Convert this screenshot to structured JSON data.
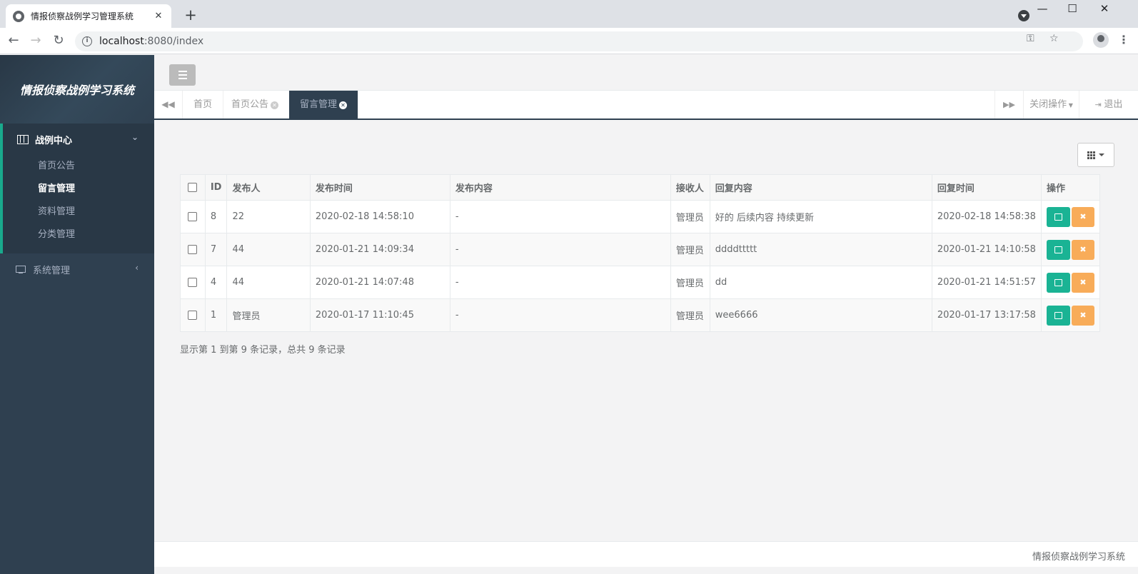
{
  "browser": {
    "tab_title": "情报侦察战例学习管理系统",
    "tab_close": "✕",
    "new_tab": "+",
    "url_host": "localhost",
    "url_rest": ":8080/index",
    "icons": [
      "globe-icon",
      "back-icon",
      "forward-icon",
      "reload-icon",
      "info-icon",
      "key-icon",
      "star-icon",
      "profile-icon",
      "menu-icon"
    ]
  },
  "sidebar": {
    "brand": "情报侦察战例学习系统",
    "group1": {
      "label": "战例中心",
      "items": [
        {
          "label": "首页公告",
          "active": false
        },
        {
          "label": "留言管理",
          "active": true
        },
        {
          "label": "资料管理",
          "active": false
        },
        {
          "label": "分类管理",
          "active": false
        }
      ]
    },
    "group2": {
      "label": "系统管理"
    }
  },
  "tabs": {
    "items": [
      {
        "label": "首页",
        "closable": false,
        "active": false
      },
      {
        "label": "首页公告",
        "closable": true,
        "active": false
      },
      {
        "label": "留言管理",
        "closable": true,
        "active": true
      }
    ],
    "close_ops": "关闭操作",
    "logout": "退出"
  },
  "table": {
    "headers": [
      "ID",
      "发布人",
      "发布时间",
      "发布内容",
      "接收人",
      "回复内容",
      "回复时间",
      "操作"
    ],
    "rows": [
      {
        "id": "8",
        "publisher": "22",
        "pub_time": "2020-02-18 14:58:10",
        "content": "-",
        "receiver": "管理员",
        "reply": "好的 后续内容 持续更新",
        "reply_time": "2020-02-18 14:58:38"
      },
      {
        "id": "7",
        "publisher": "44",
        "pub_time": "2020-01-21 14:09:34",
        "content": "-",
        "receiver": "管理员",
        "reply": "ddddttttt",
        "reply_time": "2020-01-21 14:10:58"
      },
      {
        "id": "4",
        "publisher": "44",
        "pub_time": "2020-01-21 14:07:48",
        "content": "-",
        "receiver": "管理员",
        "reply": "dd",
        "reply_time": "2020-01-21 14:51:57"
      },
      {
        "id": "1",
        "publisher": "管理员",
        "pub_time": "2020-01-17 11:10:45",
        "content": "-",
        "receiver": "管理员",
        "reply": "wee6666",
        "reply_time": "2020-01-17 13:17:58"
      }
    ]
  },
  "pager_info": "显示第 1 到第 9 条记录，总共 9 条记录",
  "footer": "情报侦察战例学习系统",
  "colors": {
    "sidebar": "#2f4050",
    "accent": "#1ab394",
    "warning": "#f8ac59"
  }
}
